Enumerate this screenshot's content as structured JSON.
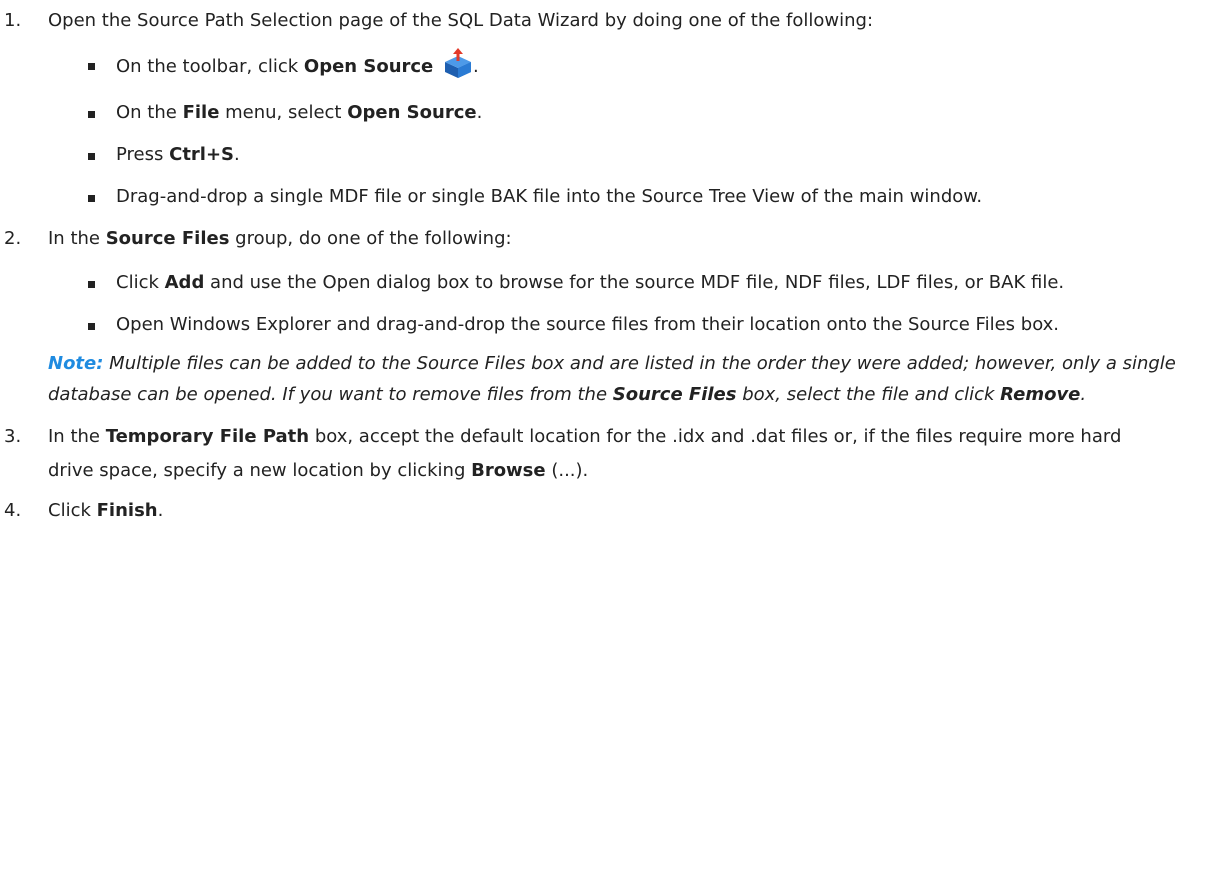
{
  "steps": [
    {
      "number": "1.",
      "text": "Open the Source Path Selection page of the SQL Data Wizard by doing one of the following:",
      "bullets": {
        "b1": {
          "pre": "On the toolbar, click ",
          "bold": "Open Source",
          "post": ".",
          "icon": "open-source-icon"
        },
        "b2": {
          "pre": "On the ",
          "bold1": "File",
          "mid": " menu, select ",
          "bold2": "Open Source",
          "post": "."
        },
        "b3": {
          "pre": "Press ",
          "bold": "Ctrl+S",
          "post": "."
        },
        "b4": {
          "text": "Drag-and-drop a single MDF file or single BAK file into the Source Tree View of the main window."
        }
      }
    },
    {
      "number": "2.",
      "pre": "In the ",
      "bold": "Source Files",
      "post": " group, do one of the following:",
      "bullets": {
        "b1": {
          "pre": "Click ",
          "bold": "Add",
          "post": " and use the Open dialog box to browse for the source MDF file, NDF files, LDF files, or BAK file."
        },
        "b2": {
          "text": "Open Windows Explorer and drag-and-drop the source files from their location onto the Source Files box."
        }
      }
    },
    {
      "number": "3.",
      "pre": "In the ",
      "bold": "Temporary File Path",
      "mid": " box, accept the default location for the .idx and .dat files or, if the files require more hard drive space, specify a new location by clicking ",
      "bold2": "Browse",
      "post": " (...)."
    },
    {
      "number": "4.",
      "pre": "Click ",
      "bold": "Finish",
      "post": "."
    }
  ],
  "note": {
    "label": "Note:",
    "text1": " Multiple files can be added to the Source Files box and are listed in the order they were added; however, only a single database can be opened. If you want to remove files from the ",
    "bold1": "Source Files",
    "text2": " box, select the file and click ",
    "bold2": "Remove",
    "text3": "."
  },
  "colors": {
    "note_label": "#1f8be0",
    "text": "#222222",
    "icon_blue": "#2a7bd4",
    "icon_arrow": "#e23a2a"
  }
}
